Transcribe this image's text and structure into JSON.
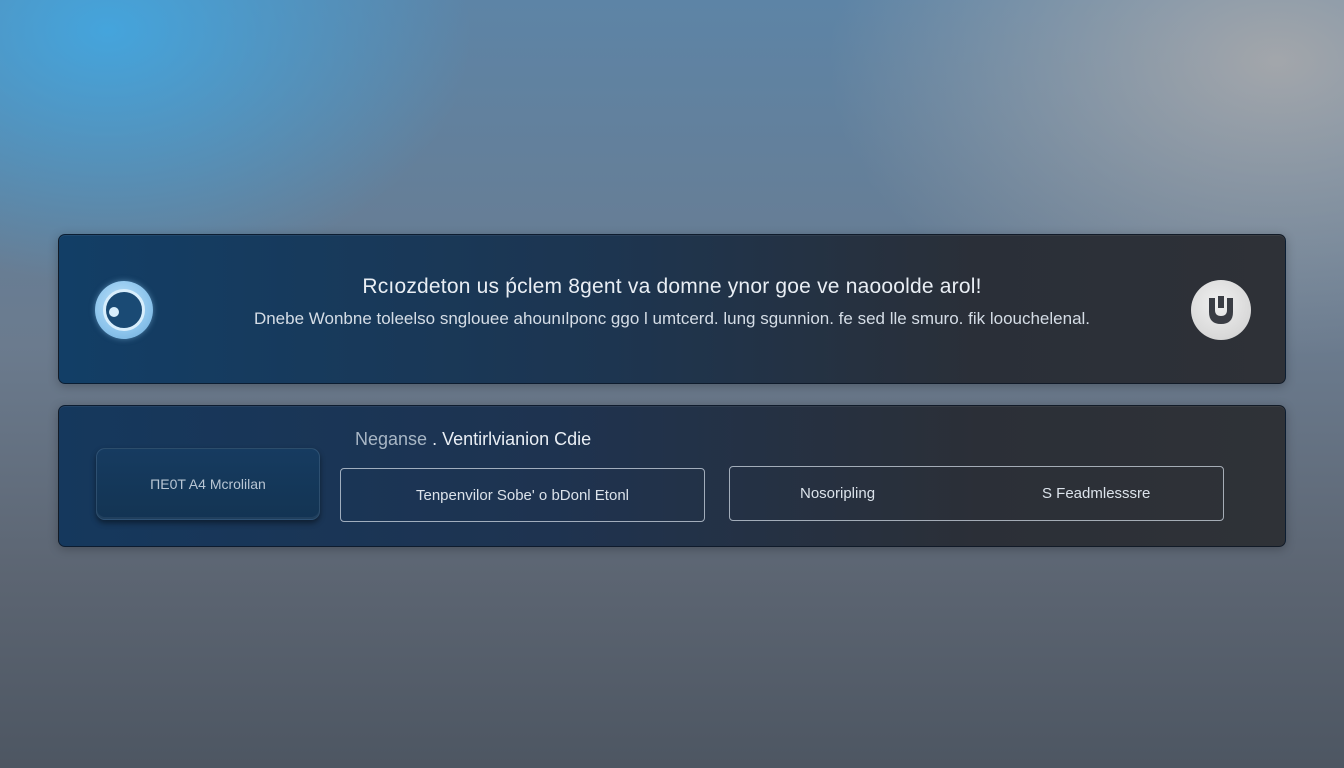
{
  "banner": {
    "title": "Rcıozdeton us  ṕclem 8gent  va  domne ynor  goe   ve  naooolde arol!",
    "subtitle": "Dnebe  Wonbne  toleelso  snglouee  ahounılponc  ggo  l umtcerd.  lung  sgunnion.  fe  sed  lle  smuro.  fik  loouchelenal.",
    "left_icon": "circle-logo-icon",
    "right_icon": "shield-emblem-icon"
  },
  "mode": {
    "prefix": "Neganse",
    "title": "Ventirlvianion  Cdie",
    "card_label": "ΠE0T A4 Mcrolilan",
    "mid_button": "Tenpenvilor  Sobe'  o  bDonl  Etonl",
    "right_button_a": "Nosoripling",
    "right_button_b": "S  Feadmlesssre"
  },
  "colors": {
    "accent_blue": "#123e66",
    "panel_dark": "#2e3137",
    "text_light": "#e9eef4"
  }
}
